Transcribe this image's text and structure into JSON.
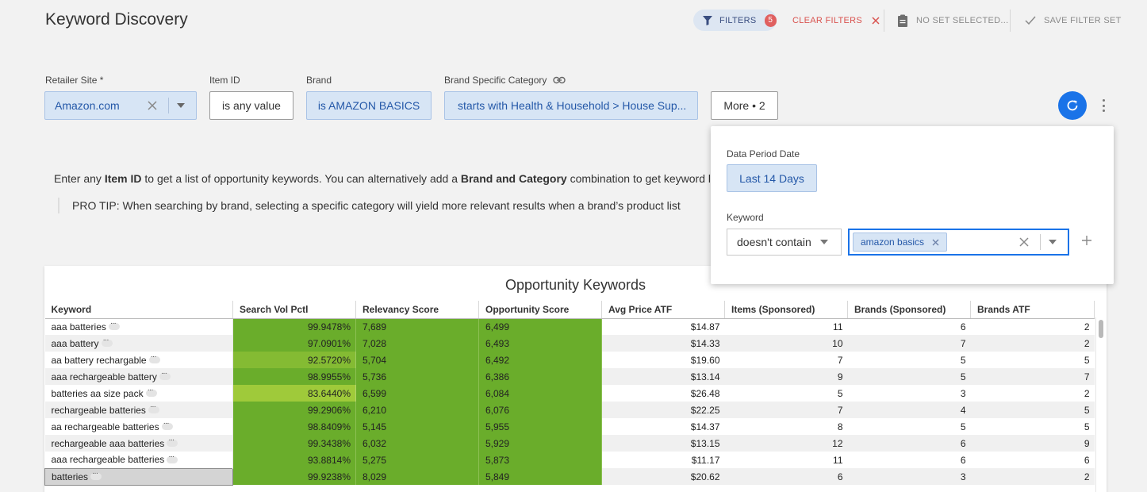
{
  "header": {
    "title": "Keyword Discovery",
    "filters_label": "FILTERS",
    "filters_count": "5",
    "clear_filters_label": "CLEAR FILTERS",
    "no_set_label": "NO SET SELECTED...",
    "save_set_label": "SAVE FILTER SET"
  },
  "filters": {
    "retailer_site": {
      "label": "Retailer Site *",
      "value": "Amazon.com"
    },
    "item_id": {
      "label": "Item ID",
      "value": "is any value"
    },
    "brand": {
      "label": "Brand",
      "value": "is AMAZON BASICS"
    },
    "brand_category": {
      "label": "Brand Specific Category",
      "value": "starts with Health & Household > House Sup..."
    },
    "more": {
      "label": "More • 2"
    }
  },
  "intro": {
    "pre": "Enter any ",
    "bold1": "Item ID",
    "mid": " to get a list of opportunity keywords. You can alternatively add a ",
    "bold2": "Brand and Category",
    "post": " combination to get keyword list",
    "protip": "PRO TIP: When searching by brand, selecting a specific category will yield more relevant results when a brand’s product list"
  },
  "popover": {
    "period_label": "Data Period Date",
    "period_value": "Last 14 Days",
    "keyword_label": "Keyword",
    "keyword_operator": "doesn't contain",
    "keyword_chip": "amazon basics"
  },
  "table": {
    "title": "Opportunity Keywords",
    "columns": [
      "Keyword",
      "Search Vol Pctl",
      "Relevancy Score",
      "Opportunity Score",
      "Avg Price ATF",
      "Items (Sponsored)",
      "Brands (Sponsored)",
      "Brands ATF"
    ],
    "rows": [
      {
        "keyword": "aaa batteries",
        "svp": "99.9478%",
        "rel": "7,689",
        "opp": "6,499",
        "price": "$14.87",
        "items": "11",
        "brands_sp": "6",
        "brands_atf": "2",
        "shade": "g"
      },
      {
        "keyword": "aaa battery",
        "svp": "97.0901%",
        "rel": "7,028",
        "opp": "6,493",
        "price": "$14.33",
        "items": "10",
        "brands_sp": "7",
        "brands_atf": "2",
        "shade": "g"
      },
      {
        "keyword": "aa battery rechargable",
        "svp": "92.5720%",
        "rel": "5,704",
        "opp": "6,492",
        "price": "$19.60",
        "items": "7",
        "brands_sp": "5",
        "brands_atf": "5",
        "shade": "g-mid"
      },
      {
        "keyword": "aaa rechargeable battery",
        "svp": "98.9955%",
        "rel": "5,736",
        "opp": "6,386",
        "price": "$13.14",
        "items": "9",
        "brands_sp": "5",
        "brands_atf": "7",
        "shade": "g"
      },
      {
        "keyword": "batteries aa size pack",
        "svp": "83.6440%",
        "rel": "6,599",
        "opp": "6,084",
        "price": "$26.48",
        "items": "5",
        "brands_sp": "3",
        "brands_atf": "2",
        "shade": "g-light"
      },
      {
        "keyword": "rechargeable batteries",
        "svp": "99.2906%",
        "rel": "6,210",
        "opp": "6,076",
        "price": "$22.25",
        "items": "7",
        "brands_sp": "4",
        "brands_atf": "5",
        "shade": "g"
      },
      {
        "keyword": "aa rechargeable batteries",
        "svp": "98.8409%",
        "rel": "5,145",
        "opp": "5,955",
        "price": "$14.37",
        "items": "8",
        "brands_sp": "5",
        "brands_atf": "5",
        "shade": "g"
      },
      {
        "keyword": "rechargeable aaa batteries",
        "svp": "99.3438%",
        "rel": "6,032",
        "opp": "5,929",
        "price": "$13.15",
        "items": "12",
        "brands_sp": "6",
        "brands_atf": "9",
        "shade": "g"
      },
      {
        "keyword": "aaa rechargeable batteries",
        "svp": "93.8814%",
        "rel": "5,275",
        "opp": "5,873",
        "price": "$11.17",
        "items": "11",
        "brands_sp": "6",
        "brands_atf": "6",
        "shade": "g"
      },
      {
        "keyword": "batteries",
        "svp": "99.9238%",
        "rel": "8,029",
        "opp": "5,849",
        "price": "$20.62",
        "items": "6",
        "brands_sp": "3",
        "brands_atf": "2",
        "shade": "g"
      }
    ]
  },
  "colors": {
    "accent_blue": "#1a73e8",
    "chip_blue_bg": "#d7e5f5",
    "clear_red": "#d9534f",
    "green_high": "#6aad2b",
    "green_mid": "#84bb33",
    "green_low": "#9fca3a"
  }
}
